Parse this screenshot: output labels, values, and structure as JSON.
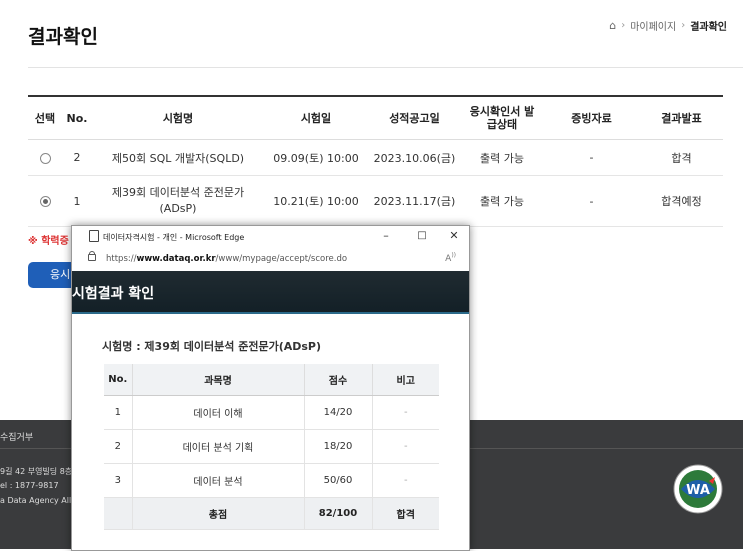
{
  "page": {
    "title": "결과확인",
    "breadcrumb": [
      "마이페이지",
      "결과확인"
    ]
  },
  "results_table": {
    "headers": [
      "선택",
      "No.",
      "시험명",
      "시험일",
      "성적공고일",
      "응시확인서 발급상태",
      "증빙자료",
      "결과발표"
    ],
    "rows": [
      {
        "no": "2",
        "exam": "제50회 SQL 개발자(SQLD)",
        "date": "09.09(토) 10:00",
        "announce": "2023.10.06(금)",
        "status": "출력 가능",
        "evidence": "-",
        "result": "합격",
        "selected": false
      },
      {
        "no": "1",
        "exam": "제39회 데이터분석 준전문가(ADsP)",
        "date": "10.21(토) 10:00",
        "announce": "2023.11.17(금)",
        "status": "출력 가능",
        "evidence": "-",
        "result": "합격예정",
        "selected": true
      }
    ]
  },
  "notice": "※ 학력증",
  "blue_button": "응시",
  "footer": {
    "left_heading": "수집거부",
    "addr": "9길 42 부영빌딩 8층",
    "tel": "el : 1877-9817",
    "copy": "a Data Agency All r"
  },
  "popup": {
    "window_title": "데이터자격시험 - 개인 - Microsoft Edge",
    "url_prefix": "https://",
    "url_domain": "www.dataq.or.kr",
    "url_path": "/www/mypage/accept/score.do",
    "header_title": "시험결과 확인",
    "exam_name": "시험명 : 제39회 데이터분석 준전문가(ADsP)",
    "score_headers": [
      "No.",
      "과목명",
      "점수",
      "비고"
    ],
    "score_rows": [
      {
        "no": "1",
        "subject": "데이터 이해",
        "score": "14/20",
        "note": "-"
      },
      {
        "no": "2",
        "subject": "데이터 분석 기획",
        "score": "18/20",
        "note": "-"
      },
      {
        "no": "3",
        "subject": "데이터 분석",
        "score": "50/60",
        "note": "-"
      }
    ],
    "total": {
      "label": "총점",
      "score": "82/100",
      "result": "합격"
    }
  },
  "icons": {
    "home": "home-icon",
    "page": "page-icon",
    "lock": "lock-icon",
    "read_aloud": "read-aloud-icon",
    "wa_badge": "web-accessibility-badge"
  }
}
